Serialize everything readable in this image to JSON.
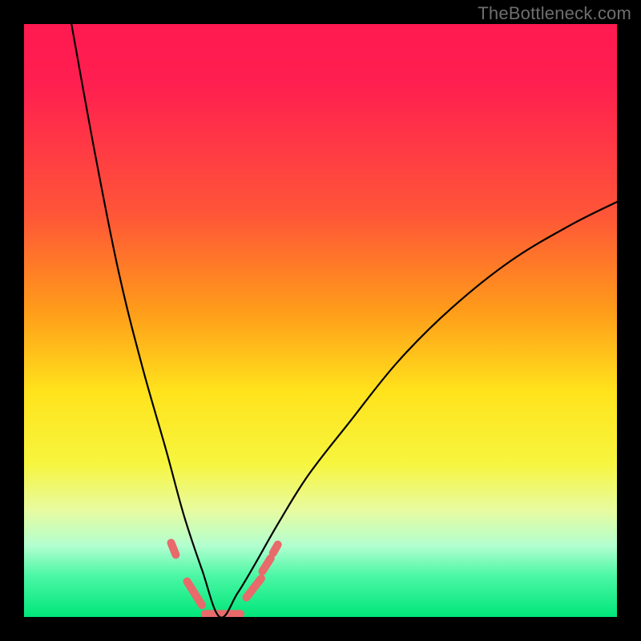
{
  "watermark": "TheBottleneck.com",
  "chart_data": {
    "type": "line",
    "title": "",
    "xlabel": "",
    "ylabel": "",
    "xlim": [
      0,
      100
    ],
    "ylim": [
      0,
      100
    ],
    "note": "V-shaped bottleneck curve over a vertical red→yellow→green heat gradient. The dip (minimum) sits near x≈33 at y≈0; the left arm goes off the top at x≈8, the right arm exits at x≈100 around y≈70. Short salmon-colored marker segments cluster near the valley.",
    "series": [
      {
        "name": "bottleneck-curve",
        "x": [
          8,
          12,
          16,
          20,
          24,
          27,
          30,
          33,
          36,
          39,
          43,
          48,
          55,
          63,
          72,
          82,
          92,
          100
        ],
        "y": [
          100,
          78,
          58,
          42,
          28,
          17,
          8,
          0,
          4,
          9,
          16,
          24,
          33,
          43,
          52,
          60,
          66,
          70
        ]
      }
    ],
    "markers": {
      "color": "#e86a6a",
      "stroke_width_px": 10,
      "segments_xy": [
        [
          [
            24.8,
            12.5
          ],
          [
            25.6,
            10.5
          ]
        ],
        [
          [
            27.5,
            6.0
          ],
          [
            30.0,
            2.0
          ]
        ],
        [
          [
            30.5,
            0.5
          ],
          [
            36.5,
            0.5
          ]
        ],
        [
          [
            37.5,
            3.3
          ],
          [
            40.0,
            6.5
          ]
        ],
        [
          [
            40.2,
            7.7
          ],
          [
            41.6,
            9.9
          ]
        ],
        [
          [
            42.0,
            10.8
          ],
          [
            42.8,
            12.2
          ]
        ]
      ]
    },
    "gradient_stops": [
      {
        "pct": 0,
        "color": "#ff1950"
      },
      {
        "pct": 10,
        "color": "#ff1f50"
      },
      {
        "pct": 32,
        "color": "#ff5538"
      },
      {
        "pct": 48,
        "color": "#ff9a1a"
      },
      {
        "pct": 62,
        "color": "#ffe31c"
      },
      {
        "pct": 74,
        "color": "#f7f53e"
      },
      {
        "pct": 82,
        "color": "#e8fba0"
      },
      {
        "pct": 88,
        "color": "#b2ffd0"
      },
      {
        "pct": 93,
        "color": "#4cf7a5"
      },
      {
        "pct": 100,
        "color": "#00e67a"
      }
    ]
  }
}
